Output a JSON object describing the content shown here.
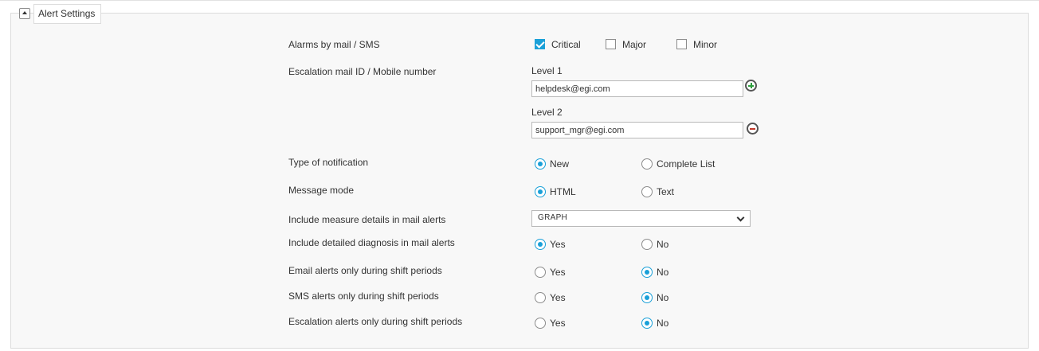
{
  "section": {
    "title": "Alert Settings"
  },
  "colors": {
    "accent": "#1aa0d8",
    "add": "#2e9e3e",
    "remove": "#c0392b"
  },
  "alarms": {
    "label": "Alarms by mail / SMS",
    "options": [
      {
        "label": "Critical",
        "checked": true
      },
      {
        "label": "Major",
        "checked": false
      },
      {
        "label": "Minor",
        "checked": false
      }
    ]
  },
  "escalation": {
    "label": "Escalation mail ID / Mobile number",
    "levels": [
      {
        "label": "Level 1",
        "value": "helpdesk@egi.com",
        "action": "add-icon"
      },
      {
        "label": "Level 2",
        "value": "support_mgr@egi.com",
        "action": "remove-icon"
      }
    ]
  },
  "notification": {
    "label": "Type of notification",
    "options": [
      "New",
      "Complete List"
    ],
    "selected": "New"
  },
  "message_mode": {
    "label": "Message mode",
    "options": [
      "HTML",
      "Text"
    ],
    "selected": "HTML"
  },
  "measure_details": {
    "label": "Include measure details in mail alerts",
    "value": "GRAPH"
  },
  "detailed_diagnosis": {
    "label": "Include detailed diagnosis in mail alerts",
    "options": [
      "Yes",
      "No"
    ],
    "selected": "Yes"
  },
  "email_shift": {
    "label": "Email alerts only during shift periods",
    "options": [
      "Yes",
      "No"
    ],
    "selected": "No"
  },
  "sms_shift": {
    "label": "SMS alerts only during shift periods",
    "options": [
      "Yes",
      "No"
    ],
    "selected": "No"
  },
  "escalation_shift": {
    "label": "Escalation alerts only during shift periods",
    "options": [
      "Yes",
      "No"
    ],
    "selected": "No"
  }
}
